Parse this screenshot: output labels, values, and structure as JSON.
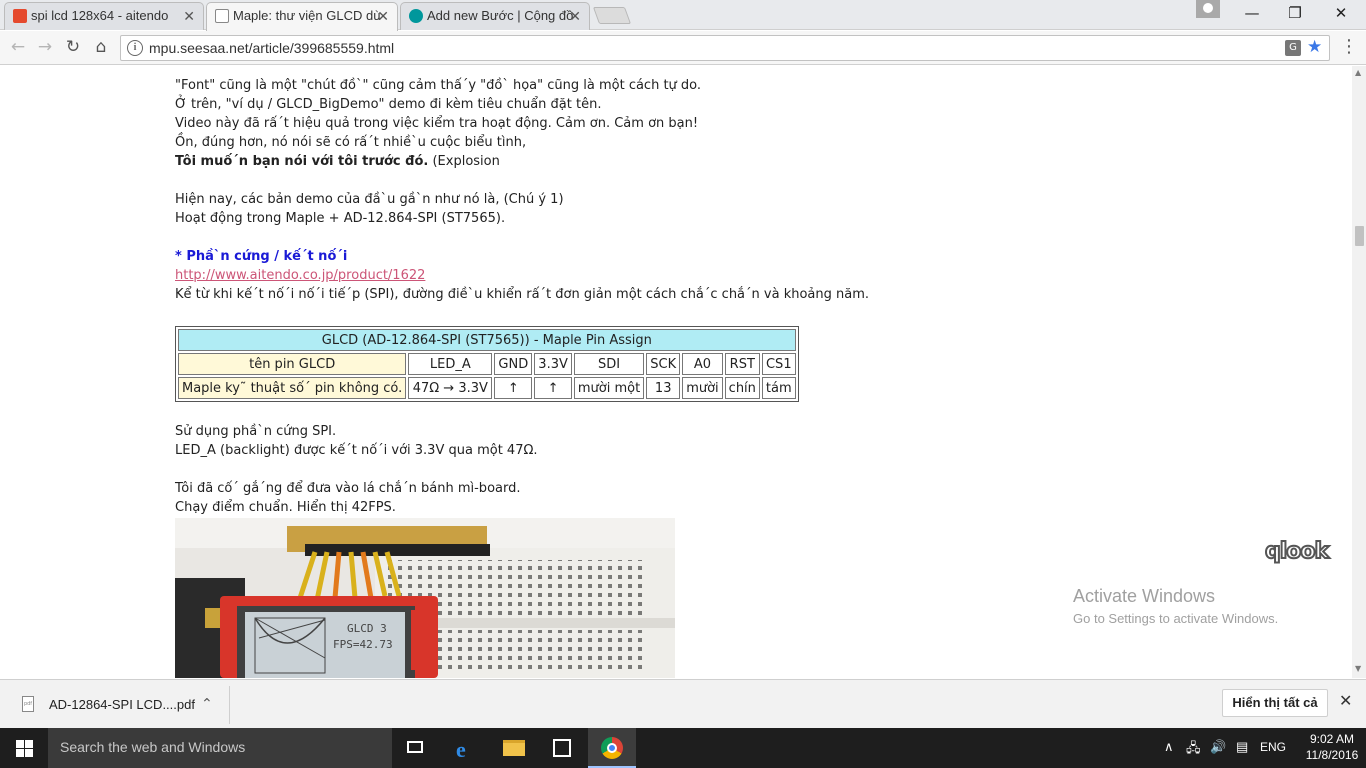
{
  "tabs": [
    {
      "title": "spi lcd 128x64 - aitendo",
      "favicon": "aitendo-icon"
    },
    {
      "title": "Maple: thư viện GLCD dù",
      "favicon": "page-icon"
    },
    {
      "title": "Add new Bước | Cộng đồ",
      "favicon": "arduino-icon"
    }
  ],
  "address_bar": {
    "url": "mpu.seesaa.net/article/399685559.html"
  },
  "article": {
    "lines_1": [
      "\"Font\" cũng là một \"chút đồ`\" cũng cảm thấ´y \"đồ` họa\" cũng là một cách tự do.",
      "Ở trên, \"ví dụ / GLCD_BigDemo\" demo đi kèm tiêu chuẩn đặt tên.",
      "Video này đã rấ´t hiệu quả trong việc kiểm tra hoạt động. Cảm ơn. Cảm ơn bạn!",
      "Ồn, đúng hơn, nó nói sẽ có rấ´t nhiề`u cuộc biểu tình,"
    ],
    "line_bold": "Tôi muố´n bạn nói với tôi trước đó.",
    "line_bold_tail": " (Explosion",
    "lines_2": [
      "Hiện nay, các bản demo của đầ`u gầ`n như nó là, (Chú ý 1)",
      "Hoạt động trong Maple + AD-12.864-SPI (ST7565)."
    ],
    "hardware_heading": "* Phầ`n cứng / kế´t nố´i",
    "hardware_link": " http://www.aitendo.co.jp/product/1622",
    "line_spi": "Kể từ khi kế´t nố´i nố´i tiế´p (SPI), đường điề`u khiển rấ´t đơn giản một cách chắ´c chắ´n và khoảng năm.",
    "table": {
      "caption": "GLCD (AD-12.864-SPI (ST7565)) - Maple Pin Assign",
      "header": [
        "tên pin GLCD",
        "LED_A",
        "GND",
        "3.3V",
        "SDI",
        "SCK",
        "A0",
        "RST",
        "CS1"
      ],
      "row": [
        "Maple ky˜ thuật số´ pin không có.",
        "47Ω → 3.3V",
        "↑",
        "↑",
        "mười một",
        "13",
        "mười",
        "chín",
        "tám"
      ]
    },
    "lines_3": [
      "Sử dụng phầ`n cứng SPI.",
      "LED_A (backlight) được kế´t nố´i với 3.3V qua một 47Ω."
    ],
    "lines_4": [
      "Tôi đã cố´ gắ´ng để đưa vào lá chắ´n bánh mì-board.",
      "Chạy điểm chuẩn. Hiển thị 42FPS."
    ],
    "photo_lcd": {
      "line1": "GLCD 3",
      "line2": "FPS=42.73"
    }
  },
  "overlay": {
    "qlook": "qlook",
    "activate_title": "Activate Windows",
    "activate_sub": "Go to Settings to activate Windows."
  },
  "downloads": {
    "file_name": "AD-12864-SPI LCD....pdf",
    "file_type": "pdf",
    "show_all": "Hiển thị tất cả"
  },
  "taskbar": {
    "search_placeholder": "Search the web and Windows",
    "language": "ENG",
    "time": "9:02 AM",
    "date": "11/8/2016"
  },
  "colors": {
    "link": "#cc5577",
    "heading_blue": "#1a1ad6",
    "table_caption_bg": "#b0ecf4",
    "table_header_bg": "#fff9d8"
  }
}
